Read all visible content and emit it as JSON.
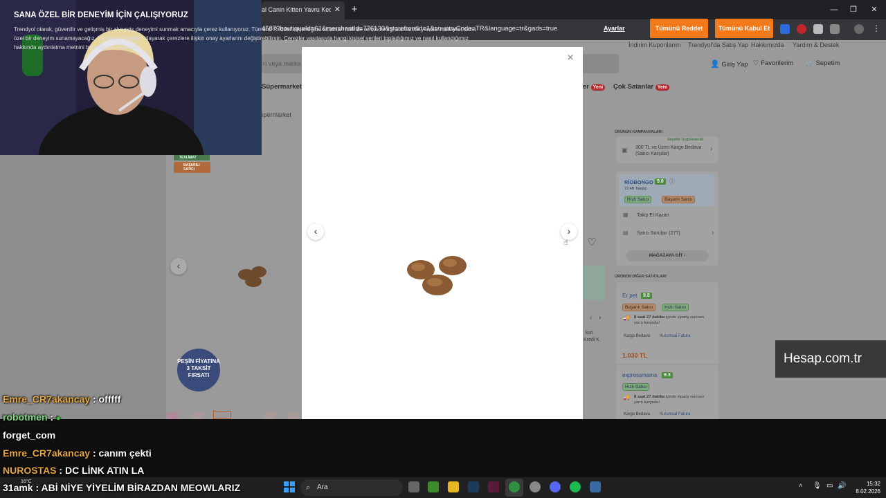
{
  "browser": {
    "tab_title": "al Canin Kitten Yavru Kedi M",
    "tab_close": "✕",
    "new_tab": "+",
    "url": "4587?boutiqueId=61&merchantId=776130&storefrontId=1&countryCode=TR&language=tr&gads=true",
    "window_min": "—",
    "window_restore": "❐",
    "window_close": "✕"
  },
  "site": {
    "top_links": [
      "İndirim Kuponlarım",
      "Trendyol'da Satış Yap",
      "Hakkımızda",
      "Yardım & Destek"
    ],
    "search_placeholder": "rı veya marka a",
    "login": "Giriş Yap",
    "favorites": "Favorilerim",
    "cart": "Sepetim",
    "nav_supermarket": "Süpermarket",
    "nav_er": "er",
    "nav_new1": "Yeni",
    "nav_bestsellers": "Çok Satanlar",
    "nav_new2": "Yeni",
    "breadcrumb": "ıpermarket",
    "badge_delivery": "TESLİMAT",
    "badge_success": "BAŞARILI SATICI",
    "promo_sticker": "PEŞİN FİYATINA 3 TAKSİT FIRSATI",
    "campaign_header": "ÜRÜNÜN KAMPANYALARI",
    "campaign_tag": "Sepette Uygulanacak",
    "campaign_text": "300 TL ve Üzeri Kargo Bedava (Satıcı Karşılar)",
    "seller_name": "RİOBONGO",
    "seller_score": "9.8",
    "seller_followers": "72,4B Takipçi",
    "seller_pill_fast": "Hızlı Satıcı",
    "seller_pill_success": "Başarılı Satıcı",
    "follow_earn": "Takip Et Kazan",
    "seller_questions": "Satıcı Soruları (277)",
    "go_store": "MAĞAZAYA GİT",
    "other_sellers_header": "ÜRÜNÜN DİĞER SATICILARI",
    "other_sellers": [
      {
        "name": "Er pet",
        "score": "9.8",
        "pill1": "Başarılı Satıcı",
        "pill2": "Hızlı Satıcı",
        "ship_bold": "8 saat 27 dakika",
        "ship_rest": " içinde sipariş verirsen yarın kargoda!",
        "tag1": "Kargo Bedava",
        "tag2": "Kurumsal Fatura",
        "price": "1.030 TL"
      },
      {
        "name": "expressmama",
        "score": "9.3",
        "pill1": "Hızlı Satıcı",
        "ship_bold": "8 saat 27 dakika",
        "ship_rest": " içinde sipariş verirsen yarın kargoda!",
        "tag1": "Kargo Bedava",
        "tag2": "Kurumsal Fatura"
      }
    ],
    "side_fragment1": "ksit",
    "side_fragment2": "Kredi K"
  },
  "modal": {
    "close": "×",
    "prev": "‹",
    "next": "›"
  },
  "cookie": {
    "title": "SANA ÖZEL BİR DENEYİM İÇİN ÇALIŞIYORUZ",
    "text": "Trendyol olarak, güvenilir ve gelişmiş bir alışveriş deneyimi sunmak amacıyla çerez kullanıyoruz. Tümünü Reddet seçeneğine tıklaman halinde tercih ve ilgi alanlarına yönelik maalesef sana özel bir deneyim sunamayacağız. \"Ayarlar\" öğesine tıklayarak çerezlere ilişkin onay ayarlarını değiştirebilirsin. Çerezler vasıtasıyla hangi kişisel verileri topladığımız ve nasıl kullandığımız hakkında aydınlatma metnini buradan okuyabilirsin.",
    "settings": "Ayarlar",
    "reject": "Tümünü Reddet",
    "accept": "Tümünü Kabul Et"
  },
  "chat": [
    {
      "user": "Emre_CR7akancay",
      "sep": " : ",
      "msg": "offfff",
      "color": "or"
    },
    {
      "user": "robotmen",
      "sep": " : ",
      "msg": "",
      "color": "gr"
    },
    {
      "user": "forget_com",
      "sep": "",
      "msg": "",
      "color": "wh"
    },
    {
      "user": "Emre_CR7akancay",
      "sep": " : ",
      "msg": "canım çekti",
      "color": "or"
    },
    {
      "user": "NUROSTAS",
      "sep": " : ",
      "msg": "DC LİNK ATIN LA",
      "color": "or"
    },
    {
      "user": "31amk",
      "sep": " : ",
      "msg": "ABİ NİYE YİYELİM BİRAZDAN MEOWLARIZ",
      "color": "wh"
    }
  ],
  "taskbar": {
    "search": "Ara",
    "weather": "16°C",
    "time": "15:32",
    "date": "8.02.2026"
  },
  "watermark": "Hesap.com.tr"
}
